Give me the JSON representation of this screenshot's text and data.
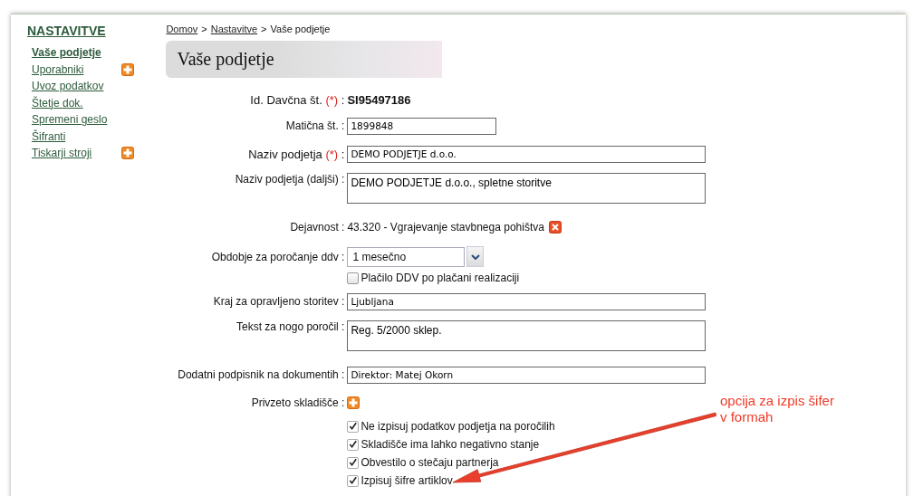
{
  "sidebar": {
    "title": "NASTAVITVE",
    "items": [
      {
        "label": "Vaše podjetje",
        "selected": true,
        "has_add": false
      },
      {
        "label": "Uporabniki",
        "selected": false,
        "has_add": true
      },
      {
        "label": "Uvoz podatkov",
        "selected": false,
        "has_add": false
      },
      {
        "label": "Štetje dok.",
        "selected": false,
        "has_add": false
      },
      {
        "label": "Spremeni geslo",
        "selected": false,
        "has_add": false
      },
      {
        "label": "Šifranti",
        "selected": false,
        "has_add": false
      },
      {
        "label": "Tiskarji stroji",
        "selected": false,
        "has_add": true
      }
    ]
  },
  "breadcrumb": [
    {
      "label": "Domov",
      "link": true
    },
    {
      "label": "Nastavitve",
      "link": true
    },
    {
      "label": "Vaše podjetje",
      "link": false
    }
  ],
  "breadcrumb_separator": ">",
  "page_title": "Vaše podjetje",
  "form": [
    {
      "kind": "text",
      "label": "Id. Davčna št.",
      "required_mark": "(*)",
      "value": "SI95497186"
    },
    {
      "kind": "short_input",
      "label": "Matična št.",
      "value": "1899848"
    },
    {
      "kind": "input",
      "label": "Naziv podjetja",
      "required_mark": "(*)",
      "value": "DEMO PODJETJE d.o.o."
    },
    {
      "kind": "textarea",
      "label": "Naziv podjetja (daljši)",
      "value": "DEMO PODJETJE d.o.o., spletne storitve"
    },
    {
      "kind": "activity",
      "label": "Dejavnost",
      "value": "43.320 - Vgrajevanje stavbnega pohištva"
    },
    {
      "kind": "select",
      "label": "Obdobje za poročanje ddv",
      "value": "1 mesečno"
    },
    {
      "kind": "checkbox",
      "label": "Plačilo DDV po plačani realizaciji",
      "checked": false
    },
    {
      "kind": "input",
      "label": "Kraj za opravljeno storitev",
      "value": "Ljubljana"
    },
    {
      "kind": "textarea",
      "label": "Tekst za nogo poročil",
      "value": "Reg. 5/2000 sklep."
    },
    {
      "kind": "input",
      "label": "Dodatni podpisnik na dokumentih",
      "value": "Direktor: Matej Okorn"
    },
    {
      "kind": "add",
      "label": "Privzeto skladišče"
    },
    {
      "kind": "spacer"
    },
    {
      "kind": "checkbox",
      "label": "Ne izpisuj podatkov podjetja na poročilih",
      "checked": true
    },
    {
      "kind": "checkbox",
      "label": "Skladišče ima lahko negativno stanje",
      "checked": true
    },
    {
      "kind": "checkbox",
      "label": "Obvestilo o stečaju partnerja",
      "checked": true
    },
    {
      "kind": "checkbox",
      "label": "Izpisuj šifre artiklov",
      "checked": true
    }
  ],
  "label_separator": ":",
  "annotation": {
    "lines": [
      "opcija za izpis šifer",
      "v formah"
    ]
  }
}
